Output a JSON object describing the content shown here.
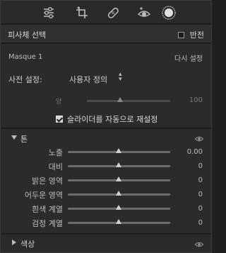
{
  "toolbar": {
    "tools": [
      {
        "icon": "sliders-icon"
      },
      {
        "icon": "crop-rotate-icon"
      },
      {
        "icon": "healing-bandage-icon"
      },
      {
        "icon": "redeye-icon"
      },
      {
        "icon": "mask-icon"
      }
    ]
  },
  "subject": {
    "title": "피사체 선택",
    "invert_label": "반전"
  },
  "mask": {
    "name": "Masque 1",
    "reset_label": "다시 설정",
    "preset_label": "사전 설정:",
    "preset_value": "사용자 정의",
    "amount_label": "양",
    "amount_value": "100",
    "amount_level": 0.5,
    "auto_reset_label": "슬라이더를 자동으로 재설정",
    "auto_reset_checked": true
  },
  "tone": {
    "title": "톤",
    "sliders": [
      {
        "label": "노출",
        "value": "0.00",
        "level": 0.5
      },
      {
        "label": "대비",
        "value": "0",
        "level": 0.5
      },
      {
        "label": "밝은 영역",
        "value": "0",
        "level": 0.5
      },
      {
        "label": "어두운 영역",
        "value": "0",
        "level": 0.5
      },
      {
        "label": "흰색 계열",
        "value": "0",
        "level": 0.5
      },
      {
        "label": "검정 계열",
        "value": "0",
        "level": 0.5
      }
    ]
  },
  "color": {
    "title": "색상"
  },
  "colors": {
    "panel_bg": "#2b2b2b",
    "track": "#6b6b6b",
    "thumb": "#d0d0d0"
  }
}
